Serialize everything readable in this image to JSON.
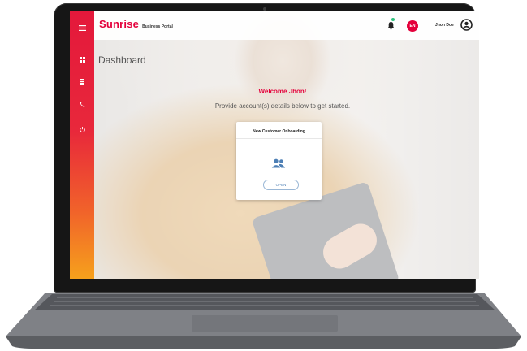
{
  "brand": {
    "name": "Sunrise",
    "subtitle": "Business Portal"
  },
  "header": {
    "language_badge": "EN",
    "user_name": "Jhon Doe",
    "notification_status_color": "#2ec27e"
  },
  "sidebar": {
    "items": [
      {
        "icon": "menu-icon"
      },
      {
        "icon": "dashboard-icon"
      },
      {
        "icon": "document-icon"
      },
      {
        "icon": "phone-icon"
      },
      {
        "icon": "power-icon"
      }
    ]
  },
  "page": {
    "title": "Dashboard",
    "welcome": "Welcome Jhon!",
    "subtitle": "Provide account(s) details below to get started."
  },
  "card": {
    "title": "New Customer Onboarding",
    "icon": "users-icon",
    "button_label": "OPEN"
  },
  "colors": {
    "brand_red": "#e4003b",
    "sidebar_top": "#e4183b",
    "sidebar_bottom": "#f6a11c",
    "link_blue": "#4d7fb5"
  }
}
